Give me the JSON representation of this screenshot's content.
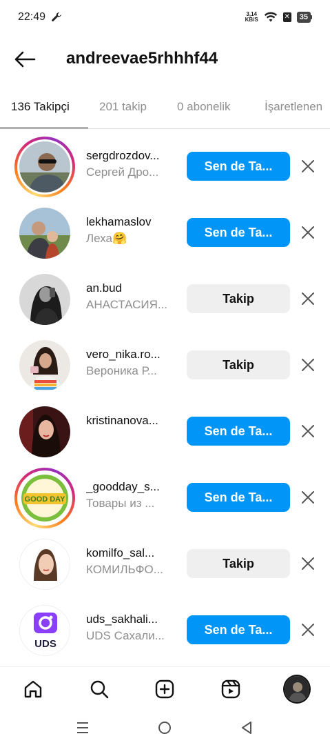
{
  "status": {
    "time": "22:49",
    "net_speed_value": "3,14",
    "net_speed_unit": "KB/S",
    "battery": "35"
  },
  "header": {
    "title": "andreevae5rhhhf44"
  },
  "tabs": [
    {
      "label": "136 Takipçi"
    },
    {
      "label": "201 takip"
    },
    {
      "label": "0 abonelik"
    },
    {
      "label": "İşaretlenen"
    }
  ],
  "followers": [
    {
      "username": "sergdrozdov...",
      "fullname": "Сергей Дро...",
      "button": "Sen de Ta..."
    },
    {
      "username": "lekhamaslov",
      "fullname": "Леха🤗",
      "button": "Sen de Ta..."
    },
    {
      "username": "an.bud",
      "fullname": "АНАСТАСИЯ...",
      "button": "Takip"
    },
    {
      "username": "vero_nika.ro...",
      "fullname": "Вероника Р...",
      "button": "Takip"
    },
    {
      "username": "kristinanova...",
      "fullname": "",
      "button": "Sen de Ta..."
    },
    {
      "username": "_goodday_s...",
      "fullname": "Товары из ...",
      "button": "Sen de Ta..."
    },
    {
      "username": "komilfo_sal...",
      "fullname": "КОМИЛЬФО...",
      "button": "Takip"
    },
    {
      "username": "uds_sakhali...",
      "fullname": "UDS Сахали...",
      "button": "Sen de Ta..."
    }
  ],
  "avatar_labels": {
    "goodday": "GOOD DAY",
    "uds": "UDS"
  },
  "icons": {
    "back": "arrow-left-icon",
    "remove": "close-icon",
    "home": "home-icon",
    "search": "search-icon",
    "create": "plus-square-icon",
    "reels": "reels-icon"
  },
  "colors": {
    "primary_button": "#0095f6",
    "secondary_button": "#efefef"
  }
}
